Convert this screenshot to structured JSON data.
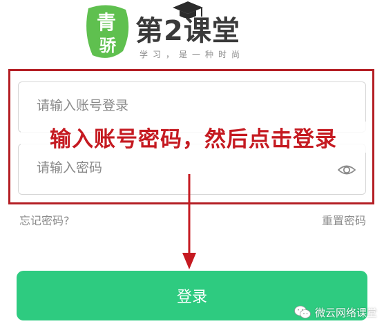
{
  "logo": {
    "badge_top": "青",
    "badge_bottom": "骄",
    "brand_prefix": "第",
    "brand_number": "2",
    "brand_suffix": "课堂",
    "slogan": "学习，是一种时尚"
  },
  "form": {
    "account_placeholder": "请输入账号登录",
    "password_placeholder": "请输入密码",
    "forgot_password": "忘记密码?",
    "reset_password": "重置密码"
  },
  "annotation": {
    "text": "输入账号密码，然后点击登录",
    "color": "#c51a21"
  },
  "login": {
    "button_label": "登录",
    "color": "#2ecb80"
  },
  "watermark": {
    "text": "微云网络课堂",
    "icon": "wechat-icon"
  }
}
